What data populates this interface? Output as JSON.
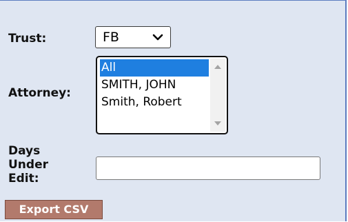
{
  "form": {
    "trust": {
      "label": "Trust:",
      "selected": "FB"
    },
    "attorney": {
      "label": "Attorney:",
      "options": [
        "All",
        "SMITH, JOHN",
        "Smith, Robert"
      ],
      "selected_index": 0
    },
    "days_under_edit": {
      "label_lines": [
        "Days",
        "Under",
        "Edit:"
      ],
      "value": "",
      "placeholder": ""
    },
    "export_button": "Export CSV"
  },
  "colors": {
    "panel_background": "#dfe6f2",
    "selection_highlight": "#1f7fe0",
    "export_button": "#b27a6c"
  }
}
